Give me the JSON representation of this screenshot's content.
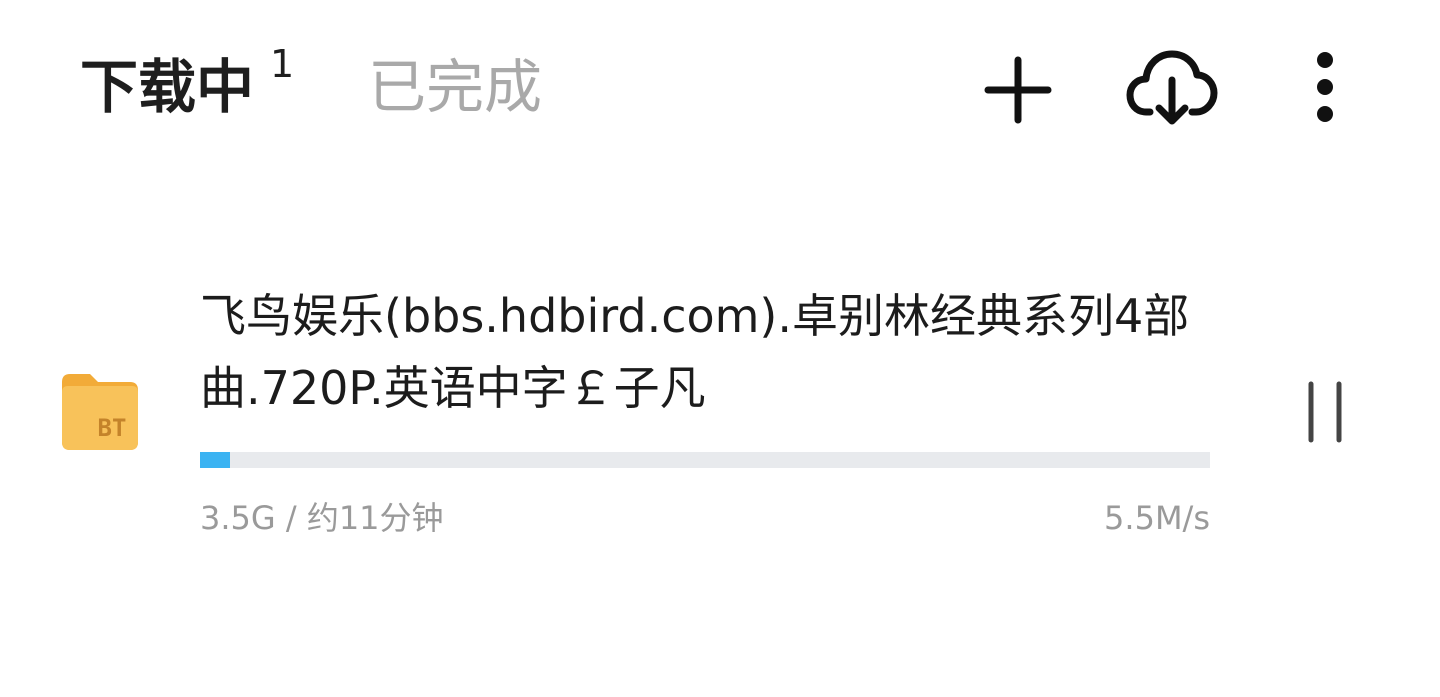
{
  "header": {
    "tabs": [
      {
        "label": "下载中",
        "count": "1",
        "active": true
      },
      {
        "label": "已完成",
        "active": false
      }
    ],
    "actions": [
      {
        "icon": "plus-icon"
      },
      {
        "icon": "cloud-download-icon"
      },
      {
        "icon": "more-vertical-icon"
      }
    ]
  },
  "task": {
    "icon": "bt-folder-icon",
    "icon_label": "BT",
    "title": "飞鸟娱乐(bbs.hdbird.com).卓别林经典系列4部曲.720P.英语中字￡子凡",
    "progress": 0.03,
    "meta": "3.5G / 约11分钟",
    "speed": "5.5M/s",
    "control_icon": "pause-icon"
  },
  "colors": {
    "accent": "#3bb3f2",
    "track": "#e8eaed",
    "folder": "#f6b94d",
    "text_primary": "#1e1e1e",
    "text_secondary": "#9a9a9a"
  }
}
